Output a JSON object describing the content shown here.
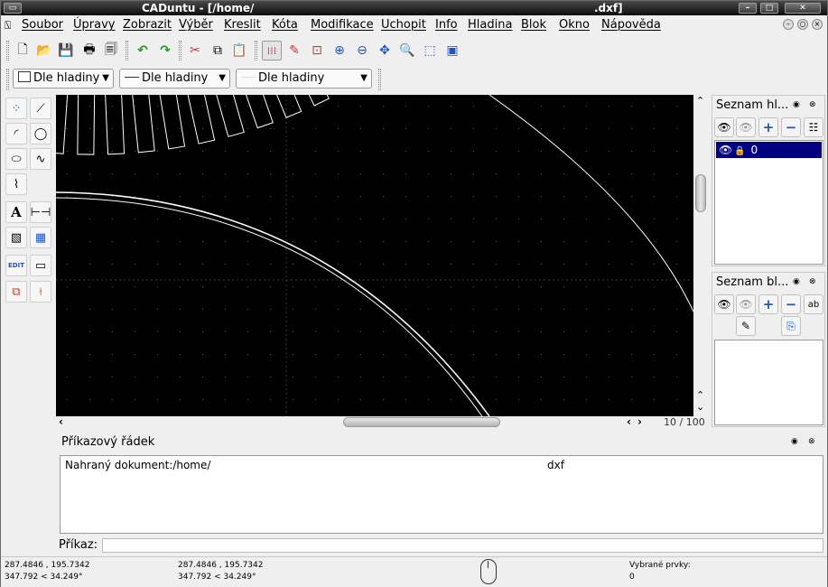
{
  "window": {
    "title_app": "CADuntu - [/home/",
    "title_ext": ".dxf]"
  },
  "menu": [
    "Soubor",
    "Úpravy",
    "Zobrazit",
    "Výběr",
    "Kreslit",
    "Kóta",
    "Modifikace",
    "Uchopit",
    "Info",
    "Hladina",
    "Blok",
    "Okno",
    "Nápověda"
  ],
  "attributes": {
    "color": "Dle hladiny",
    "linewidth": "Dle hladiny",
    "linetype": "Dle hladiny"
  },
  "scroll": {
    "page": "10 / 100"
  },
  "layer_dock": {
    "title": "Seznam hl...",
    "layers": [
      {
        "name": "0"
      }
    ]
  },
  "block_dock": {
    "title": "Seznam bl..."
  },
  "command_dock": {
    "title": "Příkazový řádek",
    "log_prefix": "Nahraný dokument:/home/",
    "log_suffix": "dxf",
    "prompt_label": "Příkaz:"
  },
  "status": {
    "abs_coord": "287.4846 , 195.7342",
    "abs_polar": "347.792 < 34.249°",
    "rel_coord": "287.4846 , 195.7342",
    "rel_polar": "347.792 < 34.249°",
    "selected_label": "Vybrané prvky:",
    "selected_count": "0"
  },
  "colors": {
    "canvas_bg": "#000000",
    "selection": "#000080",
    "accent_blue": "#1c3fa8"
  }
}
